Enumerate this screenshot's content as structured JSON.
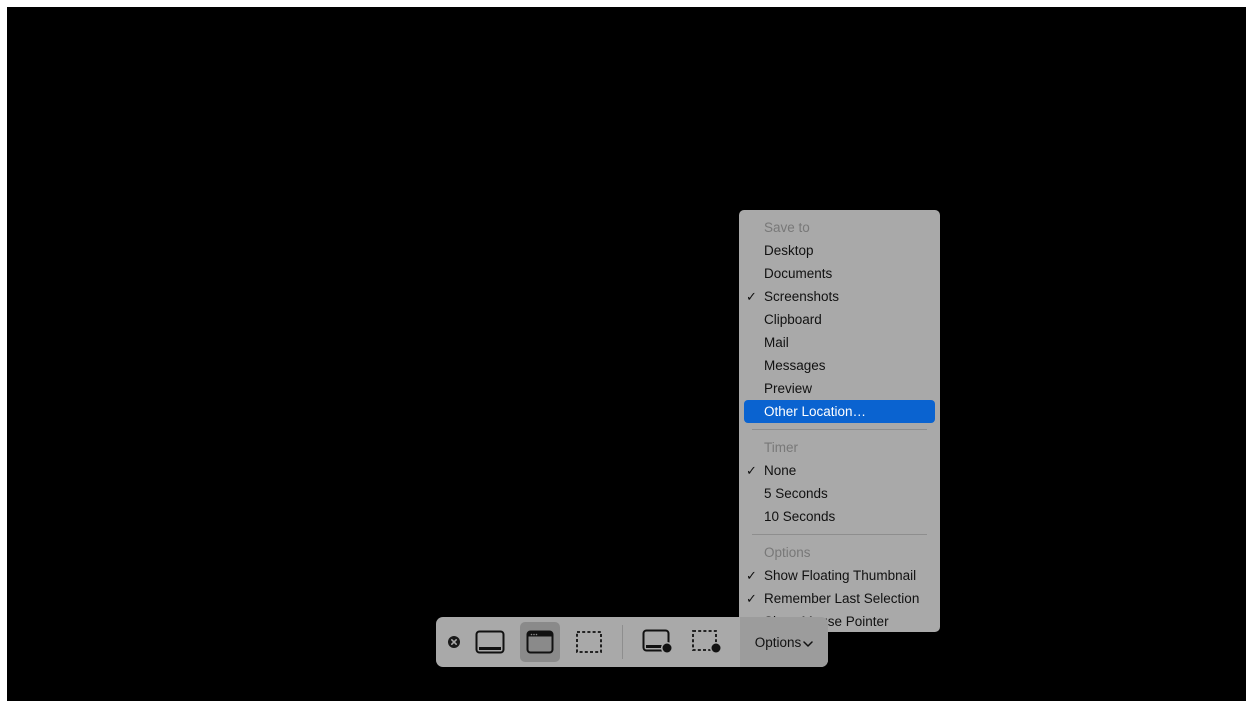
{
  "menu": {
    "sections": [
      {
        "header": "Save to",
        "items": [
          {
            "label": "Desktop",
            "checked": false,
            "highlighted": false
          },
          {
            "label": "Documents",
            "checked": false,
            "highlighted": false
          },
          {
            "label": "Screenshots",
            "checked": true,
            "highlighted": false
          },
          {
            "label": "Clipboard",
            "checked": false,
            "highlighted": false
          },
          {
            "label": "Mail",
            "checked": false,
            "highlighted": false
          },
          {
            "label": "Messages",
            "checked": false,
            "highlighted": false
          },
          {
            "label": "Preview",
            "checked": false,
            "highlighted": false
          },
          {
            "label": "Other Location…",
            "checked": false,
            "highlighted": true
          }
        ]
      },
      {
        "header": "Timer",
        "items": [
          {
            "label": "None",
            "checked": true,
            "highlighted": false
          },
          {
            "label": "5 Seconds",
            "checked": false,
            "highlighted": false
          },
          {
            "label": "10 Seconds",
            "checked": false,
            "highlighted": false
          }
        ]
      },
      {
        "header": "Options",
        "items": [
          {
            "label": "Show Floating Thumbnail",
            "checked": true,
            "highlighted": false
          },
          {
            "label": "Remember Last Selection",
            "checked": true,
            "highlighted": false
          },
          {
            "label": "Show Mouse Pointer",
            "checked": false,
            "highlighted": false
          }
        ]
      }
    ],
    "check_glyph": "✓"
  },
  "toolbar": {
    "close_icon": "close-icon",
    "buttons": [
      {
        "icon": "capture-entire-screen-icon",
        "selected": false
      },
      {
        "icon": "capture-selected-window-icon",
        "selected": true
      },
      {
        "icon": "capture-selected-portion-icon",
        "selected": false
      },
      {
        "icon": "record-entire-screen-icon",
        "selected": false
      },
      {
        "icon": "record-selected-portion-icon",
        "selected": false
      }
    ],
    "options_label": "Options",
    "options_chevron": "⌄"
  },
  "colors": {
    "screen_background": "#000000",
    "panel_background": "#a9a9a9",
    "highlight": "#0a63d0",
    "section_header_text": "#787878"
  }
}
